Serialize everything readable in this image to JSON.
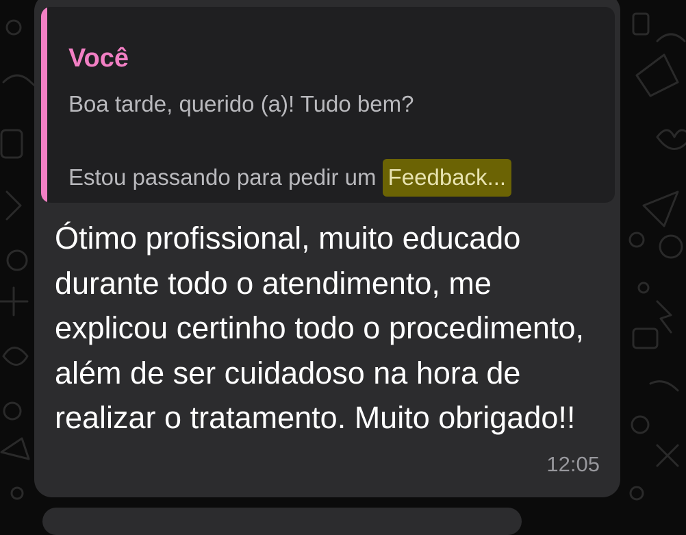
{
  "wallpaper": {
    "icon": "doodle-pattern-icon"
  },
  "reply": {
    "author": "Você",
    "line1": "Boa tarde, querido (a)! Tudo bem?",
    "line2_prefix": "Estou passando para pedir um ",
    "line2_highlight": "Feedback",
    "line2_suffix": "..."
  },
  "message": {
    "text": "Ótimo profissional, muito educado durante todo o atendimento, me explicou certinho todo o procedimento, além de ser cuidadoso na hora de realizar o tratamento. Muito obrigado!!",
    "time": "12:05"
  },
  "colors": {
    "accent": "#f27fc4",
    "bubble": "#2c2c2e",
    "quote_bg": "#1f1f21",
    "highlight": "#6b6304",
    "background": "#0b0b0b"
  }
}
